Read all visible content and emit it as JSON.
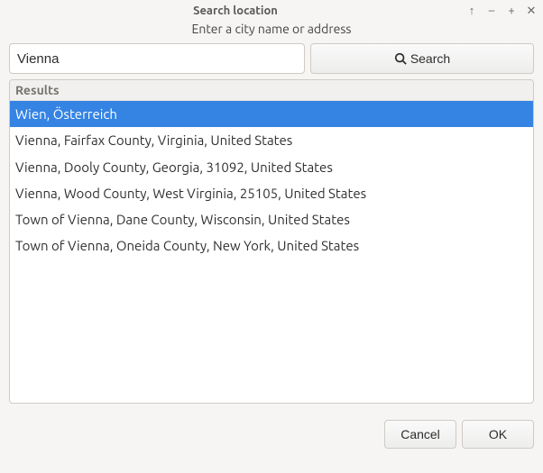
{
  "titlebar": {
    "title": "Search location"
  },
  "subtitle": "Enter a city name or address",
  "search": {
    "input_value": "Vienna",
    "button_label": "Search"
  },
  "results": {
    "header": "Results",
    "items": [
      "Wien, Österreich",
      "Vienna, Fairfax County, Virginia, United States",
      "Vienna, Dooly County, Georgia, 31092, United States",
      "Vienna, Wood County, West Virginia, 25105, United States",
      "Town of Vienna, Dane County, Wisconsin, United States",
      "Town of Vienna, Oneida County, New York, United States"
    ],
    "selected_index": 0
  },
  "footer": {
    "cancel_label": "Cancel",
    "ok_label": "OK"
  }
}
